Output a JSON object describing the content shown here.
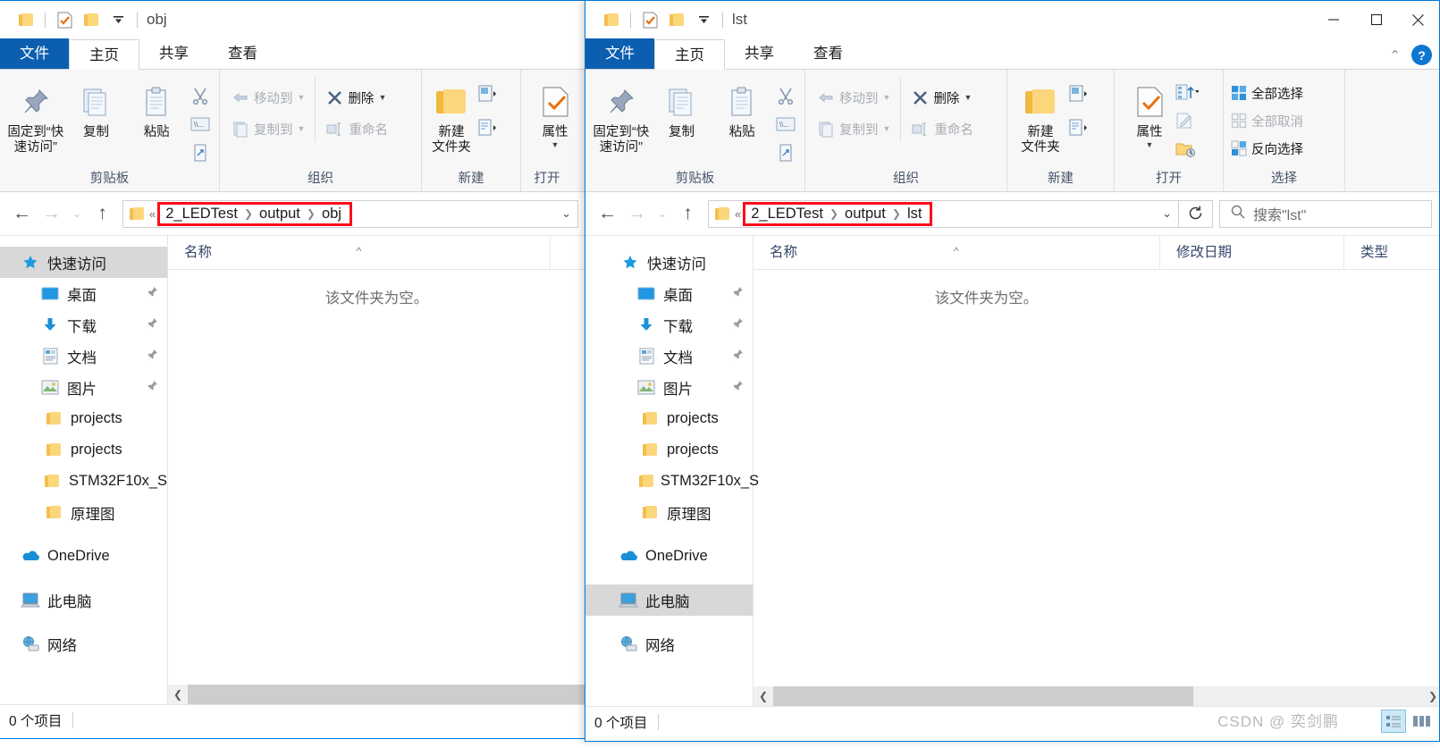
{
  "windows": [
    {
      "id": "left",
      "title": "obj",
      "quick_access": [
        "folder-icon",
        "properties-icon",
        "new-folder-icon",
        "customize-dropdown-icon"
      ],
      "tabs": [
        {
          "label": "文件",
          "kind": "file"
        },
        {
          "label": "主页",
          "kind": "active"
        },
        {
          "label": "共享",
          "kind": "normal"
        },
        {
          "label": "查看",
          "kind": "normal"
        }
      ],
      "ribbon_groups": [
        {
          "label": "剪贴板",
          "big_buttons": [
            {
              "label": "固定到“快\n速访问”",
              "icon": "pin-icon",
              "disabled": false
            },
            {
              "label": "复制",
              "icon": "copy-icon",
              "disabled": false
            },
            {
              "label": "粘贴",
              "icon": "paste-icon",
              "disabled": false
            }
          ],
          "small_icons": [
            "cut-icon",
            "copy-path-icon",
            "paste-shortcut-icon"
          ]
        },
        {
          "label": "组织",
          "small_buttons": [
            {
              "label": "移动到",
              "icon": "move-to-icon",
              "disabled": true,
              "caret": true
            },
            {
              "label": "复制到",
              "icon": "copy-to-icon",
              "disabled": true,
              "caret": true
            },
            {
              "label": "删除",
              "icon": "delete-icon",
              "disabled": false,
              "caret": true
            },
            {
              "label": "重命名",
              "icon": "rename-icon",
              "disabled": true,
              "caret": false
            }
          ]
        },
        {
          "label": "新建",
          "big_buttons": [
            {
              "label": "新建\n文件夹",
              "icon": "new-folder-icon",
              "disabled": false
            }
          ],
          "small_icons": [
            "new-item-icon",
            "easy-access-icon"
          ]
        },
        {
          "label": "打开",
          "big_buttons": [
            {
              "label": "属性",
              "icon": "properties-icon",
              "disabled": false
            }
          ]
        }
      ],
      "address": {
        "crumbs": [
          "2_LEDTest",
          "output",
          "obj"
        ],
        "highlight_color": "#fc0d1b",
        "overflow_indicator": "«"
      },
      "nav_items": [
        {
          "label": "快速访问",
          "icon": "star-pin-icon",
          "indent": 0,
          "selected": true,
          "pinned": false
        },
        {
          "label": "桌面",
          "icon": "desktop-icon",
          "indent": 1,
          "selected": false,
          "pinned": true
        },
        {
          "label": "下载",
          "icon": "downloads-icon",
          "indent": 1,
          "selected": false,
          "pinned": true
        },
        {
          "label": "文档",
          "icon": "documents-icon",
          "indent": 1,
          "selected": false,
          "pinned": true
        },
        {
          "label": "图片",
          "icon": "pictures-icon",
          "indent": 1,
          "selected": false,
          "pinned": true
        },
        {
          "label": "projects",
          "icon": "folder-icon",
          "indent": 1,
          "selected": false,
          "pinned": false
        },
        {
          "label": "projects",
          "icon": "folder-icon",
          "indent": 1,
          "selected": false,
          "pinned": false
        },
        {
          "label": "STM32F10x_S",
          "icon": "folder-icon",
          "indent": 1,
          "selected": false,
          "pinned": false
        },
        {
          "label": "原理图",
          "icon": "folder-icon",
          "indent": 1,
          "selected": false,
          "pinned": false
        },
        {
          "label": "OneDrive",
          "icon": "onedrive-icon",
          "indent": 0,
          "selected": false,
          "pinned": false,
          "gap_before": true
        },
        {
          "label": "此电脑",
          "icon": "this-pc-icon",
          "indent": 0,
          "selected": false,
          "pinned": false,
          "gap_before": true
        },
        {
          "label": "网络",
          "icon": "network-icon",
          "indent": 0,
          "selected": false,
          "pinned": false,
          "gap_before": true
        }
      ],
      "columns": [
        {
          "label": "名称",
          "sorted": true
        }
      ],
      "empty_message": "该文件夹为空。",
      "status": {
        "item_count": "0 个项目"
      }
    },
    {
      "id": "right",
      "title": "lst",
      "quick_access": [
        "folder-icon",
        "properties-icon",
        "new-folder-icon",
        "customize-dropdown-icon"
      ],
      "window_controls": [
        "minimize-icon",
        "maximize-icon",
        "close-icon"
      ],
      "tabs": [
        {
          "label": "文件",
          "kind": "file"
        },
        {
          "label": "主页",
          "kind": "active"
        },
        {
          "label": "共享",
          "kind": "normal"
        },
        {
          "label": "查看",
          "kind": "normal"
        }
      ],
      "ribbon_groups": [
        {
          "label": "剪贴板",
          "big_buttons": [
            {
              "label": "固定到“快\n速访问”",
              "icon": "pin-icon",
              "disabled": false
            },
            {
              "label": "复制",
              "icon": "copy-icon",
              "disabled": false
            },
            {
              "label": "粘贴",
              "icon": "paste-icon",
              "disabled": false
            }
          ],
          "small_icons": [
            "cut-icon",
            "copy-path-icon",
            "paste-shortcut-icon"
          ]
        },
        {
          "label": "组织",
          "small_buttons": [
            {
              "label": "移动到",
              "icon": "move-to-icon",
              "disabled": true,
              "caret": true
            },
            {
              "label": "复制到",
              "icon": "copy-to-icon",
              "disabled": true,
              "caret": true
            },
            {
              "label": "删除",
              "icon": "delete-icon",
              "disabled": false,
              "caret": true
            },
            {
              "label": "重命名",
              "icon": "rename-icon",
              "disabled": true,
              "caret": false
            }
          ]
        },
        {
          "label": "新建",
          "big_buttons": [
            {
              "label": "新建\n文件夹",
              "icon": "new-folder-icon",
              "disabled": false
            }
          ],
          "small_icons": [
            "new-item-icon",
            "easy-access-icon"
          ]
        },
        {
          "label": "打开",
          "big_buttons": [
            {
              "label": "属性",
              "icon": "properties-icon",
              "disabled": false
            }
          ],
          "small_icons": [
            "open-with-icon",
            "edit-icon",
            "history-icon"
          ]
        },
        {
          "label": "选择",
          "select_buttons": [
            {
              "label": "全部选择",
              "icon": "select-all-icon",
              "disabled": false
            },
            {
              "label": "全部取消",
              "icon": "select-none-icon",
              "disabled": true
            },
            {
              "label": "反向选择",
              "icon": "invert-selection-icon",
              "disabled": false
            }
          ]
        }
      ],
      "address": {
        "crumbs": [
          "2_LEDTest",
          "output",
          "lst"
        ],
        "highlight_color": "#fc0d1b",
        "overflow_indicator": "«"
      },
      "search": {
        "placeholder": "搜索\"lst\"",
        "icon": "search-icon"
      },
      "refresh": {
        "icon": "refresh-icon"
      },
      "nav_items": [
        {
          "label": "快速访问",
          "icon": "star-pin-icon",
          "indent": 0,
          "selected": false,
          "pinned": false
        },
        {
          "label": "桌面",
          "icon": "desktop-icon",
          "indent": 1,
          "selected": false,
          "pinned": true
        },
        {
          "label": "下载",
          "icon": "downloads-icon",
          "indent": 1,
          "selected": false,
          "pinned": true
        },
        {
          "label": "文档",
          "icon": "documents-icon",
          "indent": 1,
          "selected": false,
          "pinned": true
        },
        {
          "label": "图片",
          "icon": "pictures-icon",
          "indent": 1,
          "selected": false,
          "pinned": true
        },
        {
          "label": "projects",
          "icon": "folder-icon",
          "indent": 1,
          "selected": false,
          "pinned": false
        },
        {
          "label": "projects",
          "icon": "folder-icon",
          "indent": 1,
          "selected": false,
          "pinned": false
        },
        {
          "label": "STM32F10x_S",
          "icon": "folder-icon",
          "indent": 1,
          "selected": false,
          "pinned": false
        },
        {
          "label": "原理图",
          "icon": "folder-icon",
          "indent": 1,
          "selected": false,
          "pinned": false
        },
        {
          "label": "OneDrive",
          "icon": "onedrive-icon",
          "indent": 0,
          "selected": false,
          "pinned": false,
          "gap_before": true
        },
        {
          "label": "此电脑",
          "icon": "this-pc-icon",
          "indent": 0,
          "selected": true,
          "pinned": false,
          "gap_before": true
        },
        {
          "label": "网络",
          "icon": "network-icon",
          "indent": 0,
          "selected": false,
          "pinned": false,
          "gap_before": true
        }
      ],
      "columns": [
        {
          "label": "名称",
          "sorted": true
        },
        {
          "label": "修改日期",
          "sorted": false
        },
        {
          "label": "类型",
          "sorted": false
        }
      ],
      "empty_message": "该文件夹为空。",
      "status": {
        "item_count": "0 个项目"
      },
      "view_buttons": [
        {
          "icon": "details-view-icon",
          "active": true
        },
        {
          "icon": "large-icons-view-icon",
          "active": false
        }
      ],
      "watermark": "CSDN @ 奕剑鹏"
    }
  ]
}
